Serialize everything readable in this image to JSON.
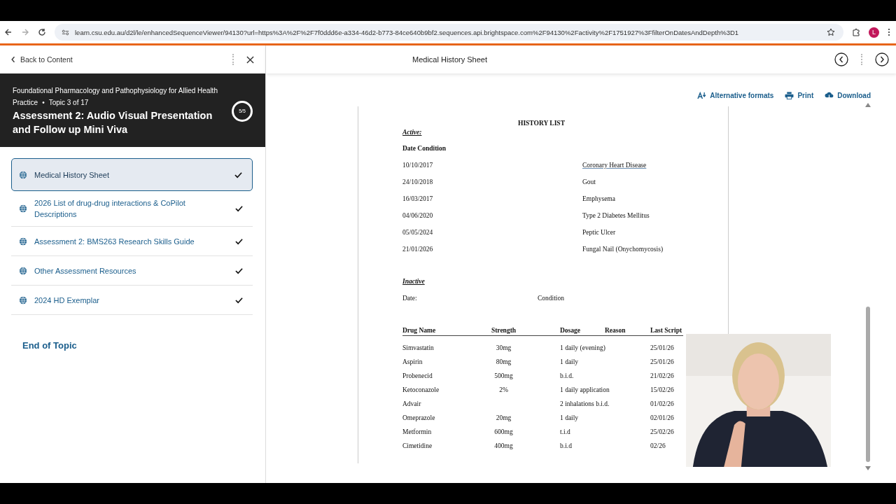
{
  "browser": {
    "url": "learn.csu.edu.au/d2l/le/enhancedSequenceViewer/94130?url=https%3A%2F%2F7f0ddd6e-a334-46d2-b773-84ce640b9bf2.sequences.api.brightspace.com%2F94130%2Factivity%2F1751927%3FfilterOnDatesAndDepth%3D1",
    "profile_initial": "L"
  },
  "sidebar": {
    "back_label": "Back to Content",
    "course": "Foundational Pharmacology and Pathophysiology for Allied Health",
    "section": "Practice",
    "separator": "•",
    "topic": "Topic 3 of 17",
    "title": "Assessment 2: Audio Visual Presentation and Follow up Mini Viva",
    "progress": "5/5",
    "items": [
      {
        "label": "Medical History Sheet",
        "selected": true,
        "completed": true
      },
      {
        "label": "2026 List of drug-drug interactions & CoPilot Descriptions",
        "selected": false,
        "completed": true
      },
      {
        "label": "Assessment 2: BMS263 Research Skills Guide",
        "selected": false,
        "completed": true
      },
      {
        "label": "Other Assessment Resources",
        "selected": false,
        "completed": true
      },
      {
        "label": "2024 HD Exemplar",
        "selected": false,
        "completed": true
      }
    ],
    "end_label": "End of Topic"
  },
  "content": {
    "title": "Medical History Sheet",
    "actions": [
      {
        "label": "Alternative formats",
        "kind": "alt"
      },
      {
        "label": "Print",
        "kind": "print"
      },
      {
        "label": "Download",
        "kind": "download"
      }
    ]
  },
  "document": {
    "heading": "HISTORY LIST",
    "active_label": "Active:",
    "active_header": "Date Condition",
    "active_rows": [
      {
        "date": "10/10/2017",
        "condition": "Coronary Heart Disease"
      },
      {
        "date": "24/10/2018",
        "condition": "Gout"
      },
      {
        "date": "16/03/2017",
        "condition": "Emphysema"
      },
      {
        "date": "04/06/2020",
        "condition": "Type 2 Diabetes Mellitus"
      },
      {
        "date": "05/05/2024",
        "condition": "Peptic Ulcer"
      },
      {
        "date": "21/01/2026",
        "condition": "Fungal Nail (Onychomycosis)"
      }
    ],
    "inactive_label": "Inactive",
    "inactive_headers": [
      "Date:",
      "Condition"
    ],
    "drug_columns": [
      "Drug Name",
      "Strength",
      "Dosage",
      "Reason",
      "Last Script"
    ],
    "drug_rows": [
      {
        "name": "Simvastatin",
        "strength": "30mg",
        "dosage": "1 daily (evening)",
        "last_script": "25/01/26"
      },
      {
        "name": "Aspirin",
        "strength": "80mg",
        "dosage": "1 daily",
        "last_script": "25/01/26"
      },
      {
        "name": "Probenecid",
        "strength": "500mg",
        "dosage": "b.i.d.",
        "last_script": "21/02/26"
      },
      {
        "name": "Ketoconazole",
        "strength": "2%",
        "dosage": "1 daily application",
        "last_script": "15/02/26"
      },
      {
        "name": "Advair",
        "dosage": "2 inhalations b.i.d.",
        "last_script": "01/02/26"
      },
      {
        "name": "Omeprazole",
        "strength": "20mg",
        "dosage": "1 daily",
        "last_script": "02/01/26"
      },
      {
        "name": "Metformin",
        "strength": "600mg",
        "dosage": "t.i.d",
        "last_script": "25/02/26"
      },
      {
        "name": "Cimetidine",
        "strength": "400mg",
        "dosage": "b.i.d",
        "last_script": "02/26"
      }
    ]
  }
}
